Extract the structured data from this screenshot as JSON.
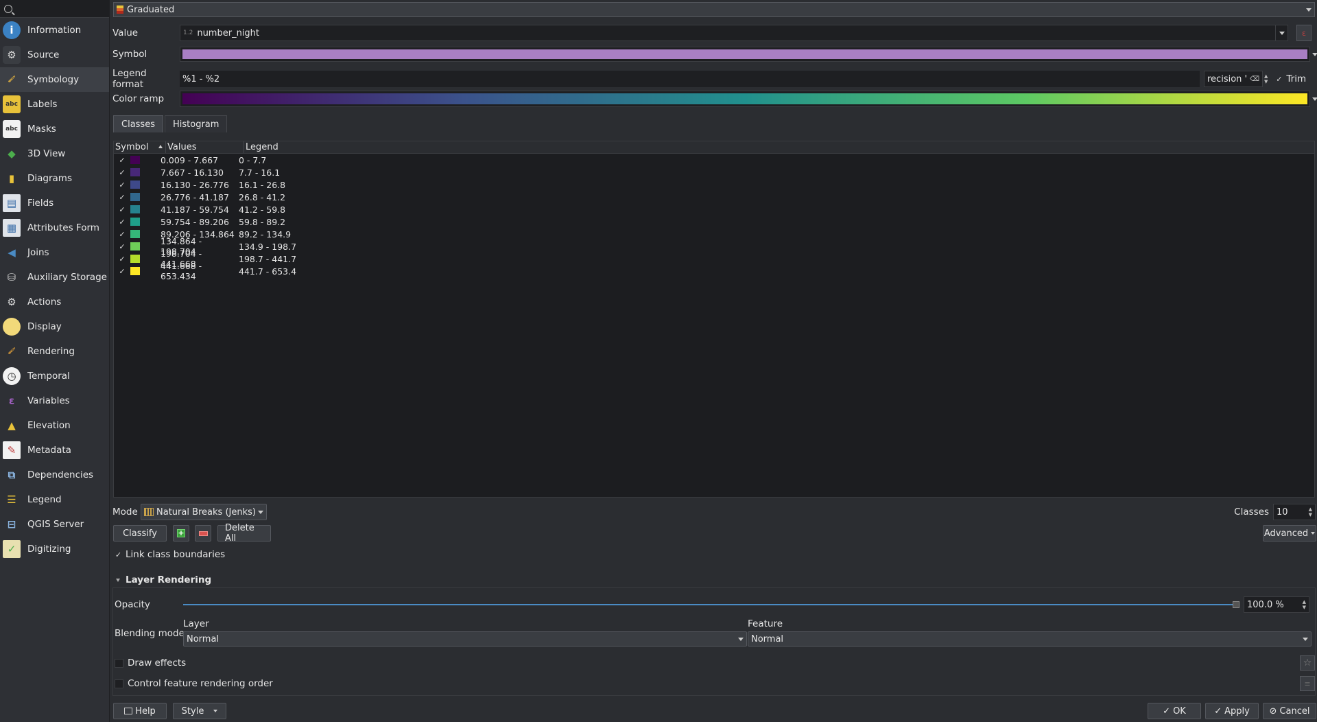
{
  "sidebar": {
    "items": [
      {
        "label": "Information",
        "icon": "info-icon"
      },
      {
        "label": "Source",
        "icon": "source-gear-icon"
      },
      {
        "label": "Symbology",
        "icon": "paintbrush-icon"
      },
      {
        "label": "Labels",
        "icon": "abc-labels-icon"
      },
      {
        "label": "Masks",
        "icon": "abc-masks-icon"
      },
      {
        "label": "3D View",
        "icon": "cube-icon"
      },
      {
        "label": "Diagrams",
        "icon": "diagrams-icon"
      },
      {
        "label": "Fields",
        "icon": "fields-icon"
      },
      {
        "label": "Attributes Form",
        "icon": "form-icon"
      },
      {
        "label": "Joins",
        "icon": "joins-icon"
      },
      {
        "label": "Auxiliary Storage",
        "icon": "database-icon"
      },
      {
        "label": "Actions",
        "icon": "actions-gear-icon"
      },
      {
        "label": "Display",
        "icon": "speech-bubble-icon"
      },
      {
        "label": "Rendering",
        "icon": "brush-icon"
      },
      {
        "label": "Temporal",
        "icon": "clock-icon"
      },
      {
        "label": "Variables",
        "icon": "variables-icon"
      },
      {
        "label": "Elevation",
        "icon": "elevation-icon"
      },
      {
        "label": "Metadata",
        "icon": "metadata-icon"
      },
      {
        "label": "Dependencies",
        "icon": "dependencies-icon"
      },
      {
        "label": "Legend",
        "icon": "legend-icon"
      },
      {
        "label": "QGIS Server",
        "icon": "server-icon"
      },
      {
        "label": "Digitizing",
        "icon": "digitizing-icon"
      }
    ],
    "active": "Symbology"
  },
  "renderer": {
    "label": "Graduated"
  },
  "value": {
    "label": "Value",
    "type_badge": "1.2",
    "field": "number_night"
  },
  "symbol": {
    "label": "Symbol",
    "color": "#a97fc4"
  },
  "legend_format": {
    "label": "Legend format",
    "value": "%1 - %2",
    "precision": "recision '",
    "trim_label": "Trim",
    "trim_check": "✓"
  },
  "color_ramp": {
    "label": "Color ramp",
    "colors": [
      "#440154",
      "#3b528b",
      "#21908d",
      "#5dc963",
      "#fde725"
    ]
  },
  "tabs": {
    "classes": "Classes",
    "histogram": "Histogram"
  },
  "table": {
    "headers": {
      "symbol": "Symbol",
      "values": "Values",
      "legend": "Legend"
    },
    "check": "✓",
    "rows": [
      {
        "color": "#440154",
        "values": "0.009 - 7.667",
        "legend": "0 - 7.7"
      },
      {
        "color": "#482878",
        "values": "7.667 - 16.130",
        "legend": "7.7 - 16.1"
      },
      {
        "color": "#3e4989",
        "values": "16.130 - 26.776",
        "legend": "16.1 - 26.8"
      },
      {
        "color": "#31688e",
        "values": "26.776 - 41.187",
        "legend": "26.8 - 41.2"
      },
      {
        "color": "#26828e",
        "values": "41.187 - 59.754",
        "legend": "41.2 - 59.8"
      },
      {
        "color": "#1f9e89",
        "values": "59.754 - 89.206",
        "legend": "59.8 - 89.2"
      },
      {
        "color": "#35b779",
        "values": "89.206 - 134.864",
        "legend": "89.2 - 134.9"
      },
      {
        "color": "#6ece58",
        "values": "134.864 - 198.704",
        "legend": "134.9 - 198.7"
      },
      {
        "color": "#b5de2b",
        "values": "198.704 - 441.668",
        "legend": "198.7 - 441.7"
      },
      {
        "color": "#fde725",
        "values": "441.668 - 653.434",
        "legend": "441.7 - 653.4"
      }
    ]
  },
  "mode": {
    "label": "Mode",
    "value": "Natural Breaks (Jenks)",
    "classes_label": "Classes",
    "classes_value": "10"
  },
  "buttons": {
    "classify": "Classify",
    "delete_all": "Delete All",
    "advanced": "Advanced",
    "help": "Help",
    "style": "Style",
    "ok": "OK",
    "apply": "Apply",
    "cancel": "Cancel"
  },
  "link_boundaries": {
    "label": "Link class boundaries",
    "check": "✓"
  },
  "layer_rendering": {
    "title": "Layer Rendering",
    "opacity_label": "Opacity",
    "opacity_value": "100.0 %",
    "opacity_fraction": 1.0,
    "blending_label": "Blending mode",
    "layer_label": "Layer",
    "layer_value": "Normal",
    "feature_label": "Feature",
    "feature_value": "Normal",
    "draw_effects": "Draw effects",
    "control_order": "Control feature rendering order"
  }
}
